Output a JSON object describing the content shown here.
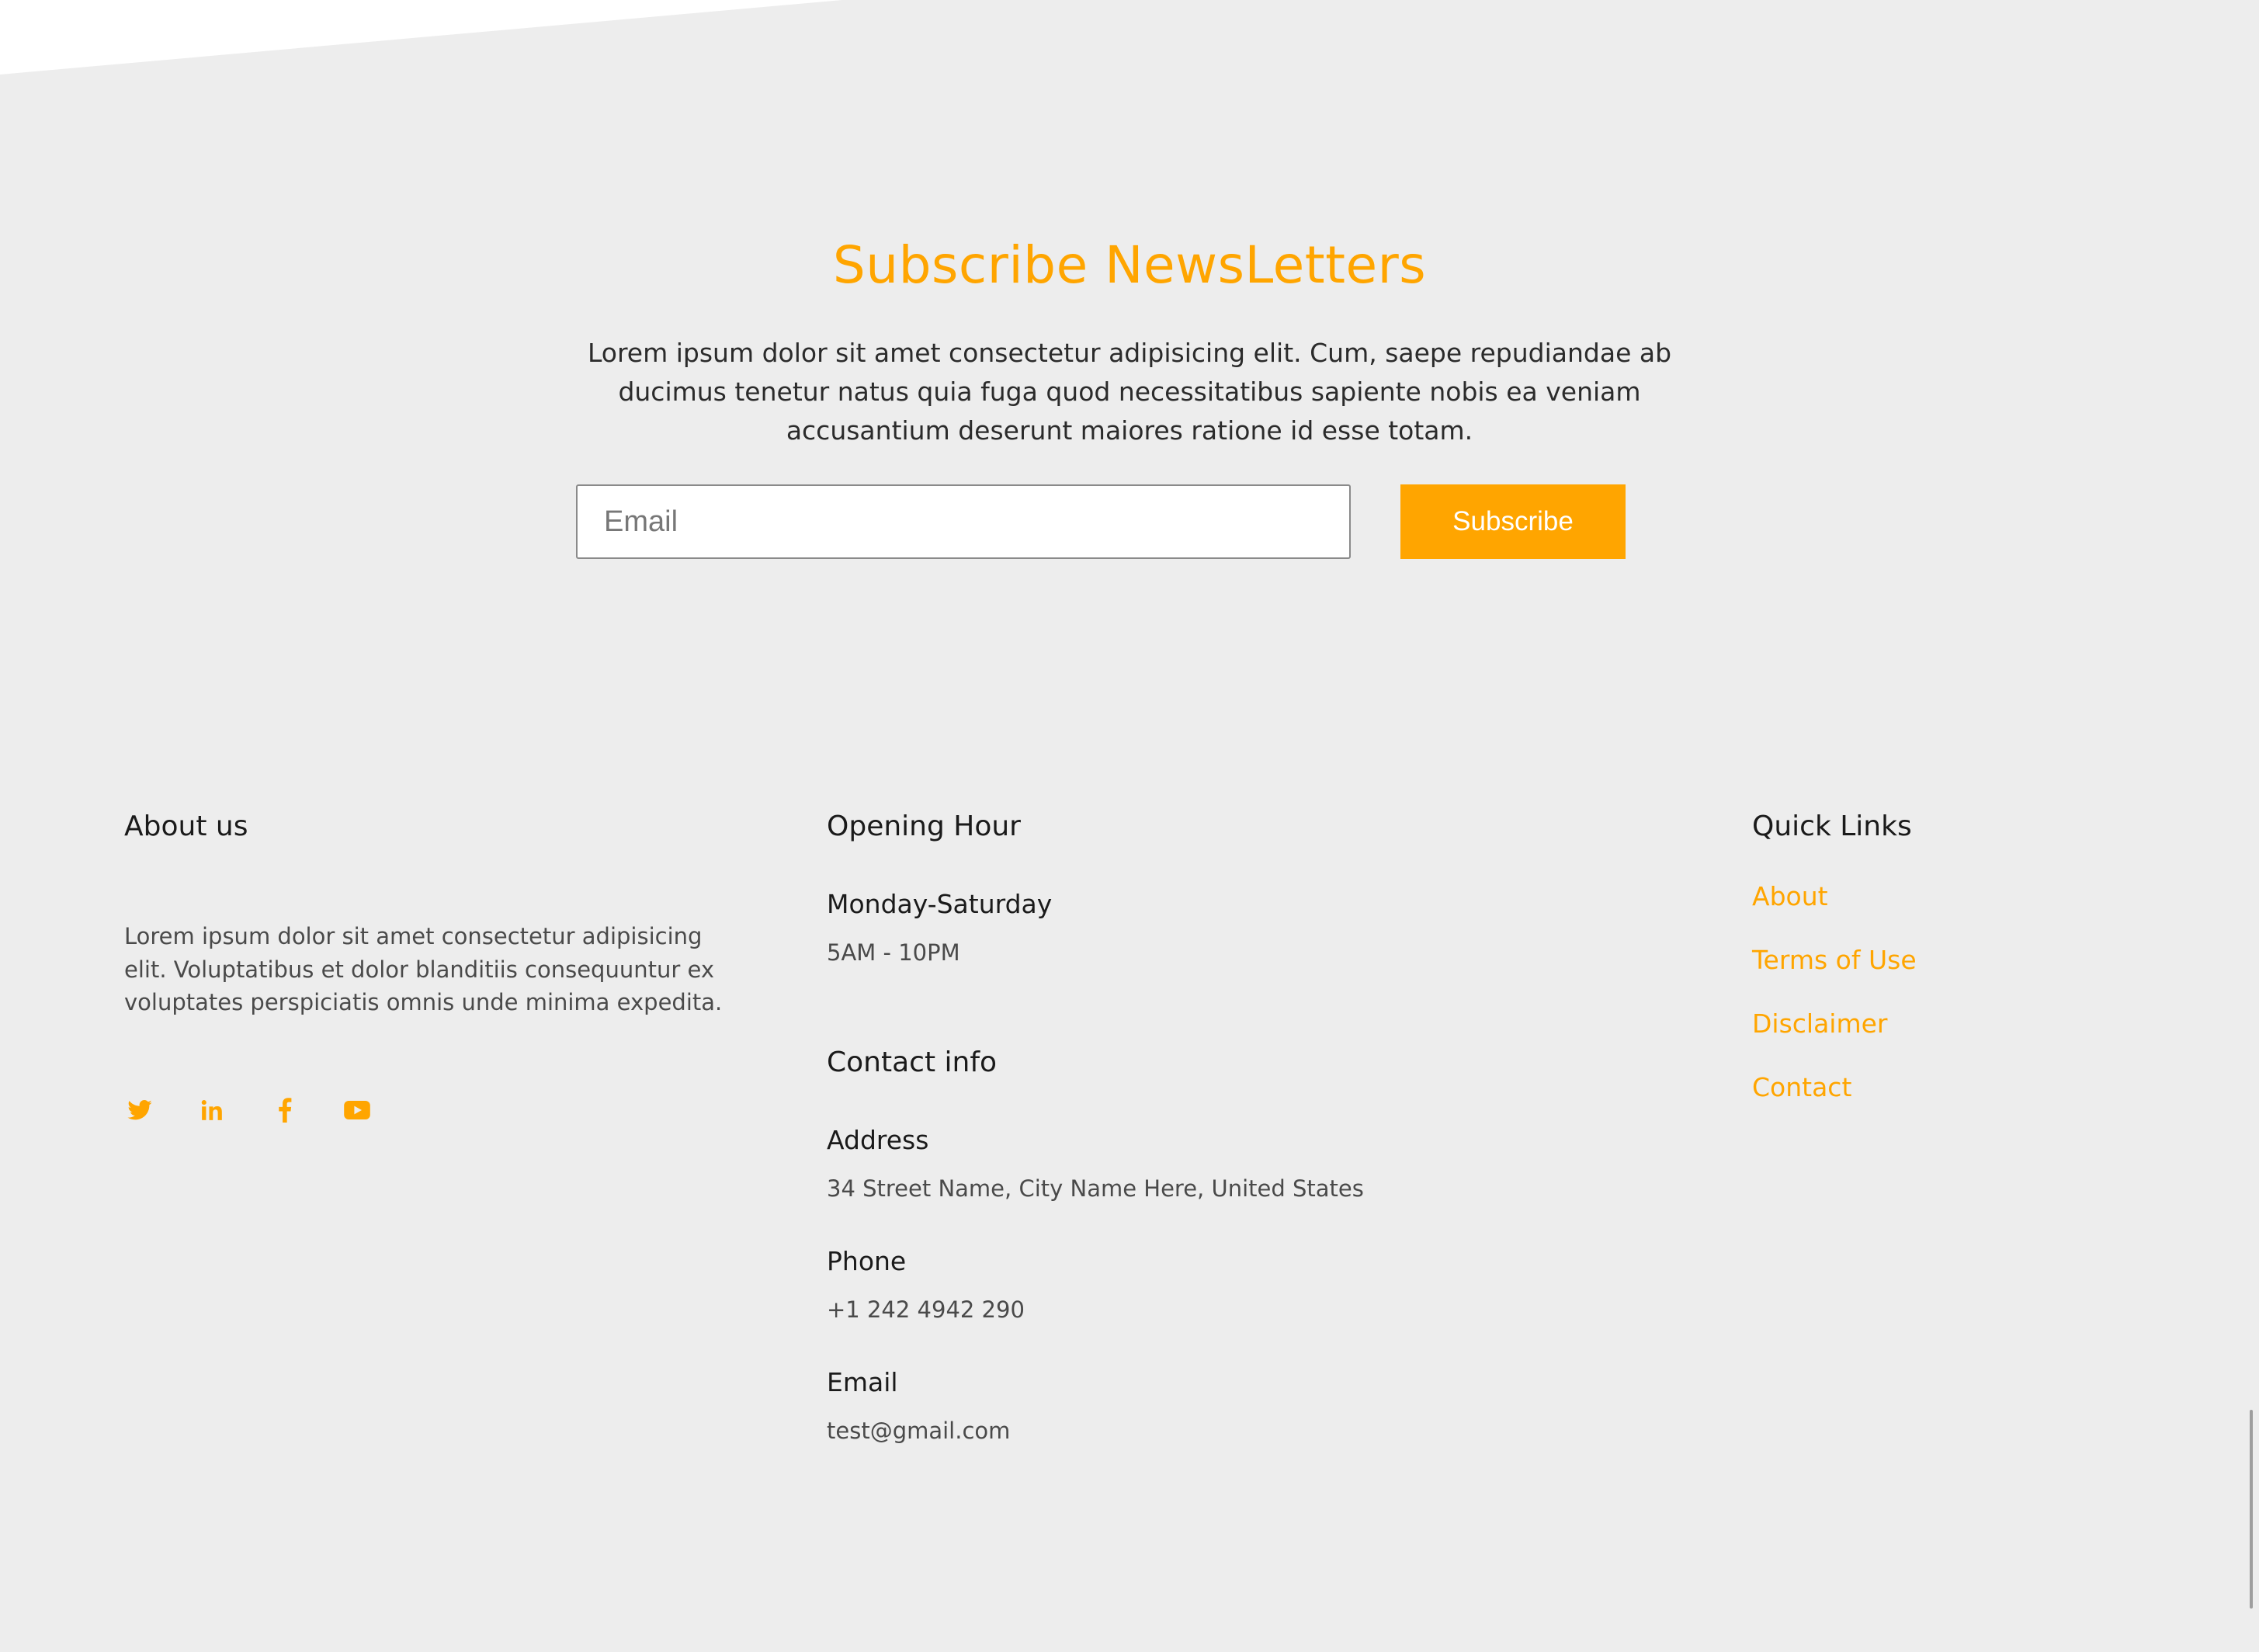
{
  "newsletter": {
    "title": "Subscribe NewsLetters",
    "description": "Lorem ipsum dolor sit amet consectetur adipisicing elit. Cum, saepe repudiandae ab ducimus tenetur natus quia fuga quod necessitatibus sapiente nobis ea veniam accusantium deserunt maiores ratione id esse totam.",
    "email_placeholder": "Email",
    "email_value": "",
    "subscribe_label": "Subscribe"
  },
  "footer": {
    "about": {
      "heading": "About us",
      "text": "Lorem ipsum dolor sit amet consectetur adipisicing elit. Voluptatibus et dolor blanditiis consequuntur ex voluptates perspiciatis omnis unde minima expedita.",
      "social": [
        {
          "icon": "twitter-icon"
        },
        {
          "icon": "linkedin-icon"
        },
        {
          "icon": "facebook-icon"
        },
        {
          "icon": "youtube-icon"
        }
      ]
    },
    "opening": {
      "heading": "Opening Hour",
      "days": "Monday-Saturday",
      "hours": "5AM - 10PM"
    },
    "contact": {
      "heading": "Contact info",
      "address_label": "Address",
      "address_value": "34 Street Name, City Name Here, United States",
      "phone_label": "Phone",
      "phone_value": "+1 242 4942 290",
      "email_label": "Email",
      "email_value": "test@gmail.com"
    },
    "quick_links": {
      "heading": "Quick Links",
      "items": [
        {
          "label": "About"
        },
        {
          "label": "Terms of Use"
        },
        {
          "label": "Disclaimer"
        },
        {
          "label": "Contact"
        }
      ]
    }
  },
  "colors": {
    "accent": "#ffa500",
    "background": "#ededed",
    "heading_text": "#1a1a1a",
    "body_text": "#4a4a4a"
  }
}
